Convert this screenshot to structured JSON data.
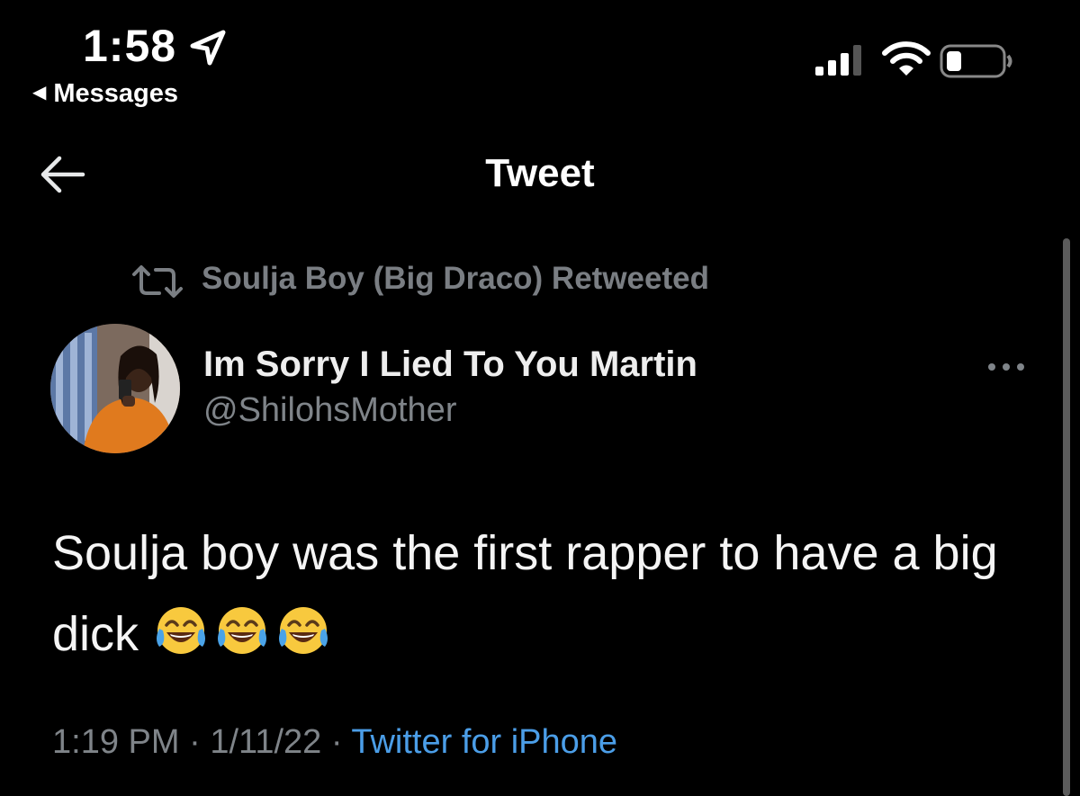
{
  "status_bar": {
    "time": "1:58",
    "back_app": "Messages"
  },
  "header": {
    "title": "Tweet"
  },
  "retweet_context": {
    "text": "Soulja Boy (Big Draco) Retweeted"
  },
  "author": {
    "display_name": "Im Sorry I Lied To You Martin",
    "handle": "@ShilohsMother"
  },
  "tweet": {
    "text": "Soulja boy was the first rapper to have a big dick",
    "emoji": [
      "face-with-tears-of-joy",
      "face-with-tears-of-joy",
      "face-with-tears-of-joy"
    ]
  },
  "meta": {
    "time": "1:19 PM",
    "separator": "·",
    "date": "1/11/22",
    "source": "Twitter for iPhone"
  },
  "colors": {
    "background": "#000000",
    "secondary_text": "#7f8489",
    "link": "#4b9ee8"
  }
}
